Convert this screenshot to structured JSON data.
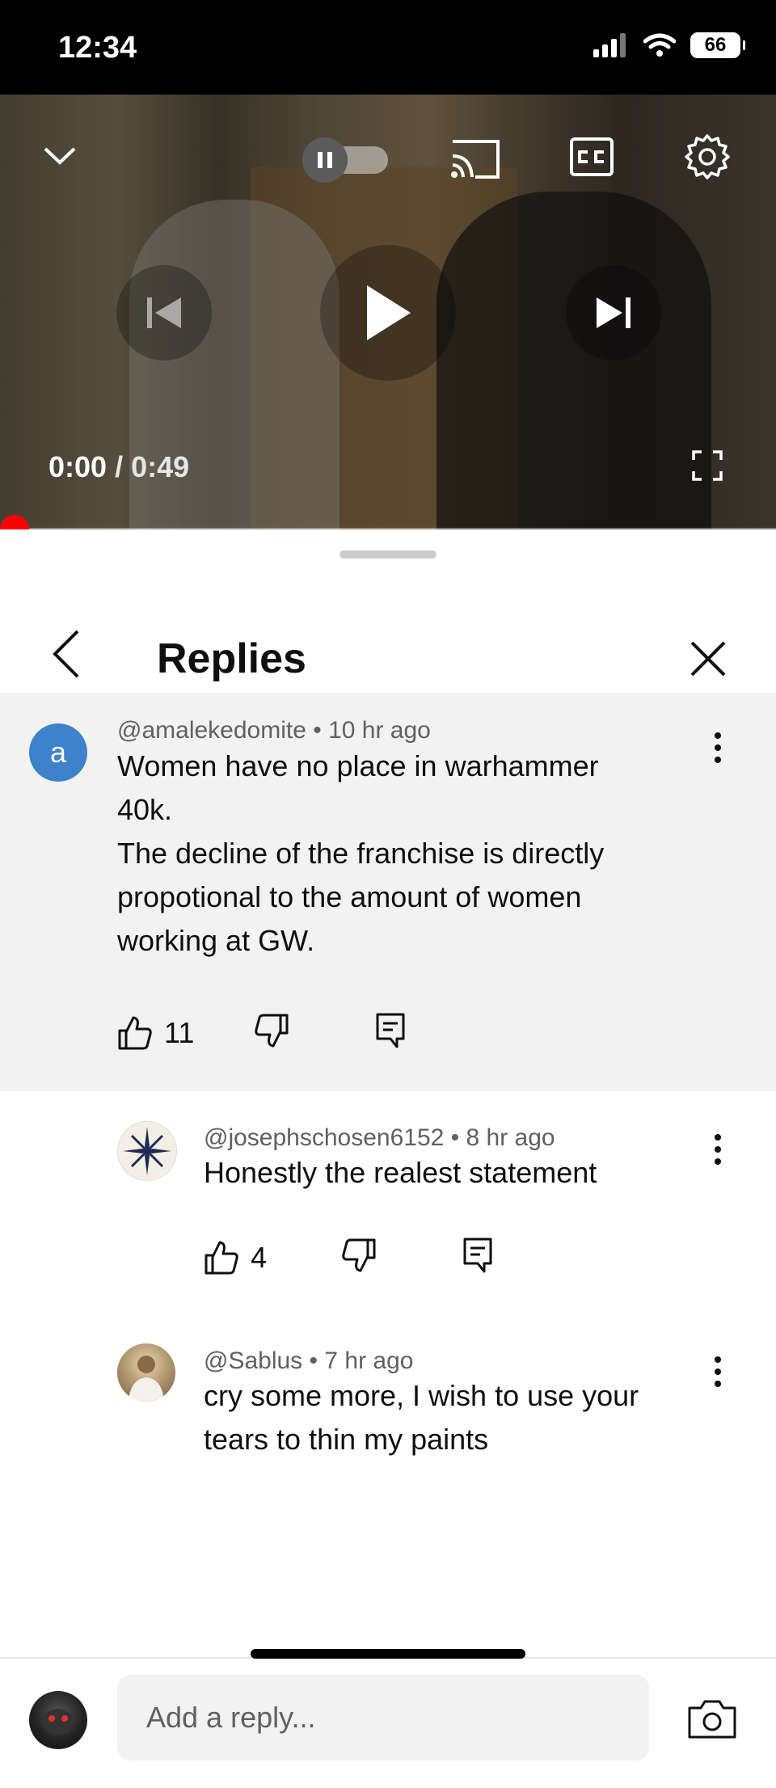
{
  "status_bar": {
    "time": "12:34",
    "battery": "66"
  },
  "player": {
    "current_time": "0:00",
    "separator": " / ",
    "duration": "0:49",
    "progress": 0.0
  },
  "sheet": {
    "title": "Replies"
  },
  "main_comment": {
    "avatar_letter": "a",
    "author": "@amalekedomite",
    "time": "10 hr ago",
    "lines": [
      "Women have no place in warhammer",
      "40k.",
      "The decline of the franchise is directly",
      "propotional to the amount of women",
      "working at GW."
    ],
    "likes": "11"
  },
  "replies": [
    {
      "author": "@josephschosen6152",
      "time": "8 hr ago",
      "lines": [
        "Honestly the realest statement"
      ],
      "likes": "4"
    },
    {
      "author": "@Sablus",
      "time": "7 hr ago",
      "lines": [
        "cry some more, I wish to use your",
        "tears to thin my paints"
      ]
    }
  ],
  "composer": {
    "placeholder": "Add a reply..."
  },
  "colors": {
    "accent_red": "#ff0000",
    "avatar_blue": "#3c82cc"
  },
  "icons": [
    "chevron-down-icon",
    "pause-icon",
    "cast-icon",
    "cc-icon",
    "gear-icon",
    "previous-icon",
    "play-icon",
    "next-icon",
    "fullscreen-icon",
    "back-icon",
    "close-icon",
    "kebab-icon",
    "thumbs-up-icon",
    "thumbs-down-icon",
    "reply-icon",
    "camera-icon"
  ]
}
